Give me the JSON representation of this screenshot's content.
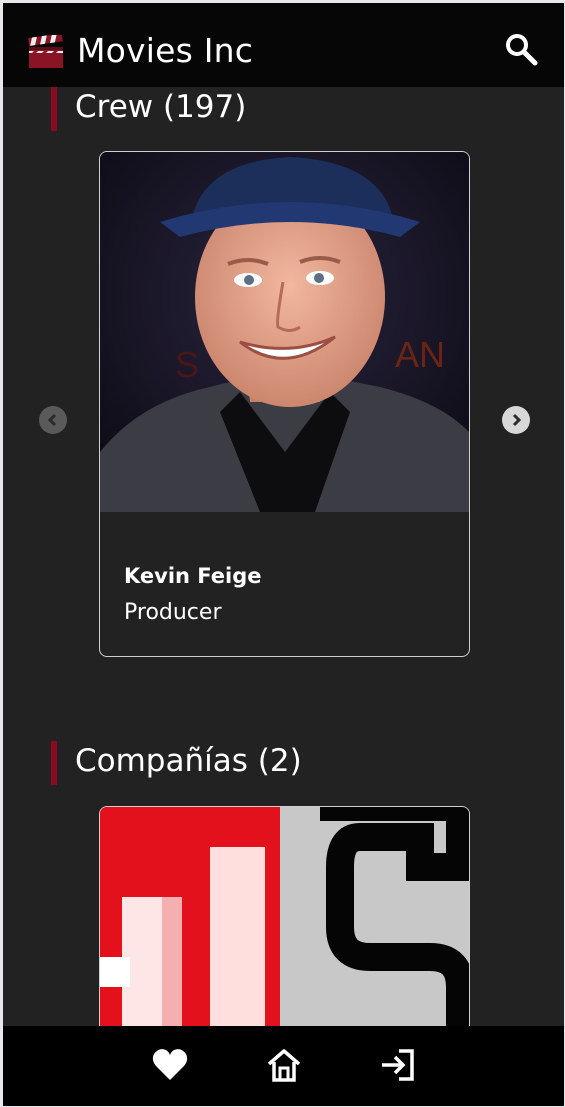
{
  "header": {
    "title": "Movies Inc",
    "logo_icon": "clapperboard-icon",
    "search_icon": "search-icon"
  },
  "crew": {
    "heading": "Crew (197)",
    "card": {
      "name": "Kevin Feige",
      "role": "Producer"
    },
    "prev_icon": "chevron-left-icon",
    "next_icon": "chevron-right-icon"
  },
  "companies": {
    "heading": "Compañías (2)"
  },
  "nav": {
    "items": [
      "heart-icon",
      "home-icon",
      "login-icon"
    ]
  },
  "colors": {
    "accent": "#8a0b1f",
    "background": "#222222",
    "header": "#060606"
  }
}
